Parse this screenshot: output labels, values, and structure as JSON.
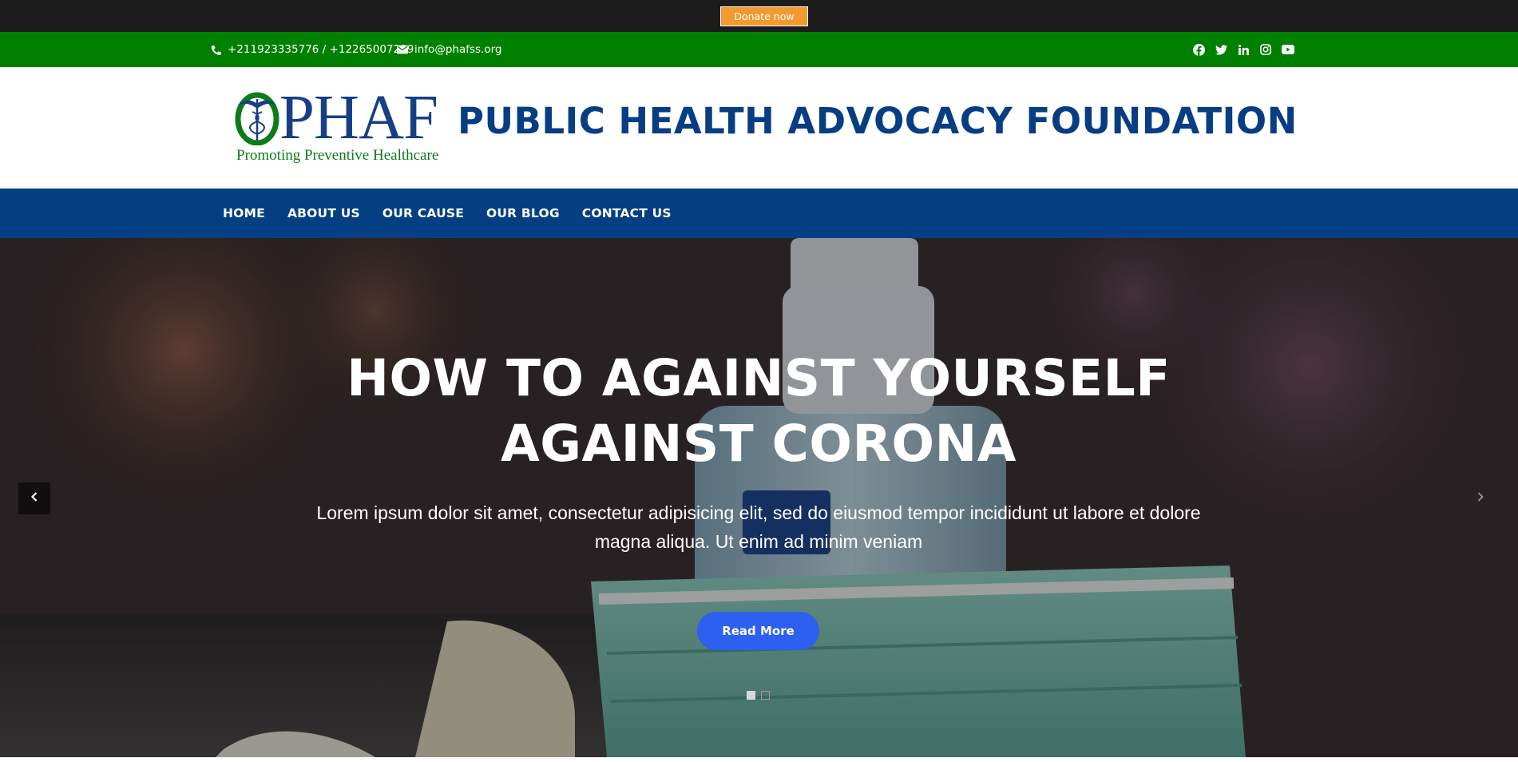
{
  "topbar": {
    "donate_label": "Donate now",
    "donate_color": "#f29a2e"
  },
  "contact": {
    "phone": "+211923335776 / +12265007209",
    "phone_icon": "phone-icon",
    "email": "info@phafss.org",
    "email_icon": "envelope-icon",
    "social_icons": [
      "facebook-icon",
      "twitter-icon",
      "linkedin-icon",
      "instagram-icon",
      "youtube-icon"
    ],
    "bar_color": "#008001"
  },
  "header": {
    "logo_letter": "O",
    "logo_word": "PHAF",
    "logo_tagline": "Promoting Preventive Healthcare",
    "org_title": "PUBLIC HEALTH ADVOCACY FOUNDATION",
    "title_color": "#073d82"
  },
  "nav": {
    "items": [
      {
        "label": "HOME"
      },
      {
        "label": "ABOUT US"
      },
      {
        "label": "OUR CAUSE"
      },
      {
        "label": "OUR BLOG"
      },
      {
        "label": "CONTACT US"
      }
    ],
    "bar_color": "#053f83"
  },
  "hero": {
    "title": "HOW TO AGAINST YOURSELF AGAINST CORONA",
    "text": "Lorem ipsum dolor sit amet, consectetur adipisicing elit, sed do eiusmod tempor incididunt ut labore et dolore magna aliqua. Ut enim ad minim veniam",
    "button_label": "Read More",
    "button_color": "#2d5ff0",
    "slides_total": 2,
    "active_slide": 1
  }
}
